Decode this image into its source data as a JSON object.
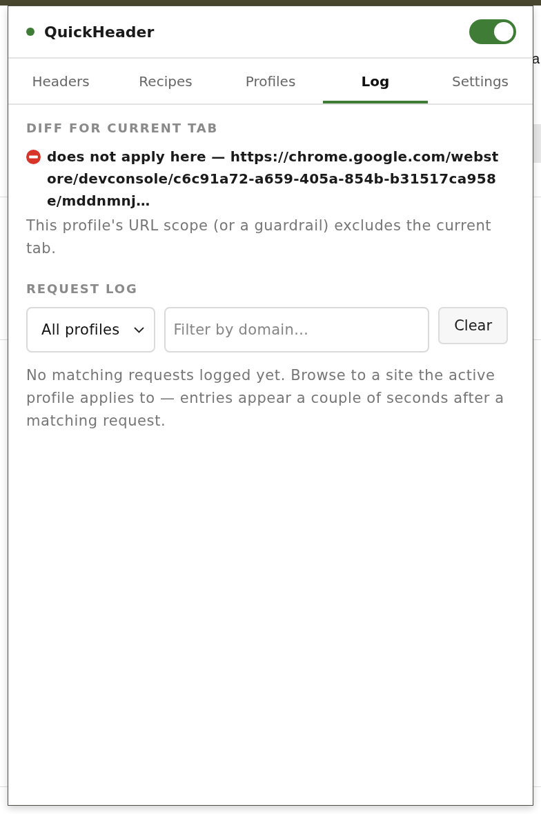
{
  "page_behind": {
    "text": "a"
  },
  "header": {
    "title": "QuickHeader",
    "enabled": true
  },
  "tabs": [
    {
      "label": "Headers",
      "selected": false
    },
    {
      "label": "Recipes",
      "selected": false
    },
    {
      "label": "Profiles",
      "selected": false
    },
    {
      "label": "Log",
      "selected": true
    },
    {
      "label": "Settings",
      "selected": false
    }
  ],
  "diff_section": {
    "heading": "DIFF FOR CURRENT TAB",
    "status": "does not apply here — https://chrome.google.com/webstore/devconsole/c6c91a72-a659-405a-854b-b31517ca958e/mddnmnj…",
    "note": "This profile's URL scope (or a guardrail) excludes the current tab."
  },
  "request_log": {
    "heading": "REQUEST LOG",
    "profile_select": {
      "value": "All profiles"
    },
    "filter": {
      "placeholder": "Filter by domain…"
    },
    "clear_button": "Clear",
    "empty_message": "No matching requests logged yet. Browse to a site the active profile applies to — entries appear a couple of seconds after a matching request."
  }
}
